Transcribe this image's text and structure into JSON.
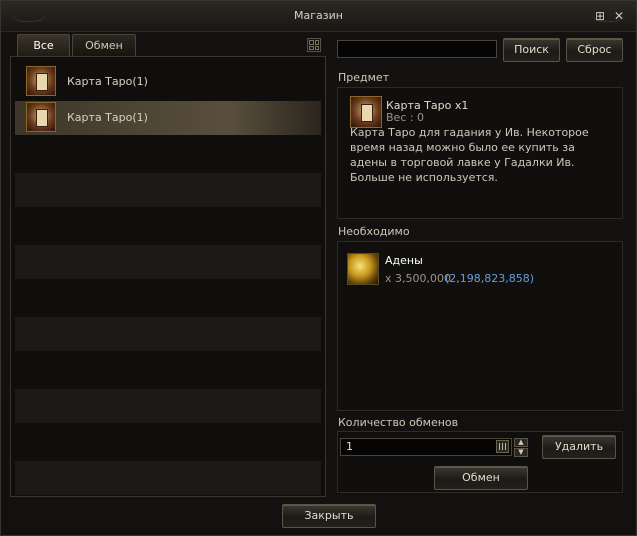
{
  "window": {
    "title": "Магазин"
  },
  "tabs": [
    {
      "label": "Все",
      "active": true
    },
    {
      "label": "Обмен",
      "active": false
    }
  ],
  "list": {
    "items": [
      {
        "label": "Карта Таро(1)",
        "icon": "tarot-card-icon",
        "selected": false
      },
      {
        "label": "Карта Таро(1)",
        "icon": "tarot-card-icon",
        "selected": true
      }
    ]
  },
  "search": {
    "value": "",
    "search_label": "Поиск",
    "reset_label": "Сброс"
  },
  "item": {
    "section_label": "Предмет",
    "name": "Карта Таро x1",
    "weight": "Вес : 0",
    "description": "Карта Таро для гадания у Ив. Некоторое время назад можно было ее купить за адены в торговой лавке у Гадалки Ив. Больше не используется."
  },
  "required": {
    "section_label": "Необходимо",
    "name": "Адены",
    "amount": "x 3,500,000",
    "owned": "(2,198,823,858)",
    "owned_color": "#6a9be0"
  },
  "quantity": {
    "section_label": "Количество обменов",
    "value": "1",
    "delete_label": "Удалить",
    "exchange_label": "Обмен"
  },
  "footer": {
    "close_label": "Закрыть"
  }
}
